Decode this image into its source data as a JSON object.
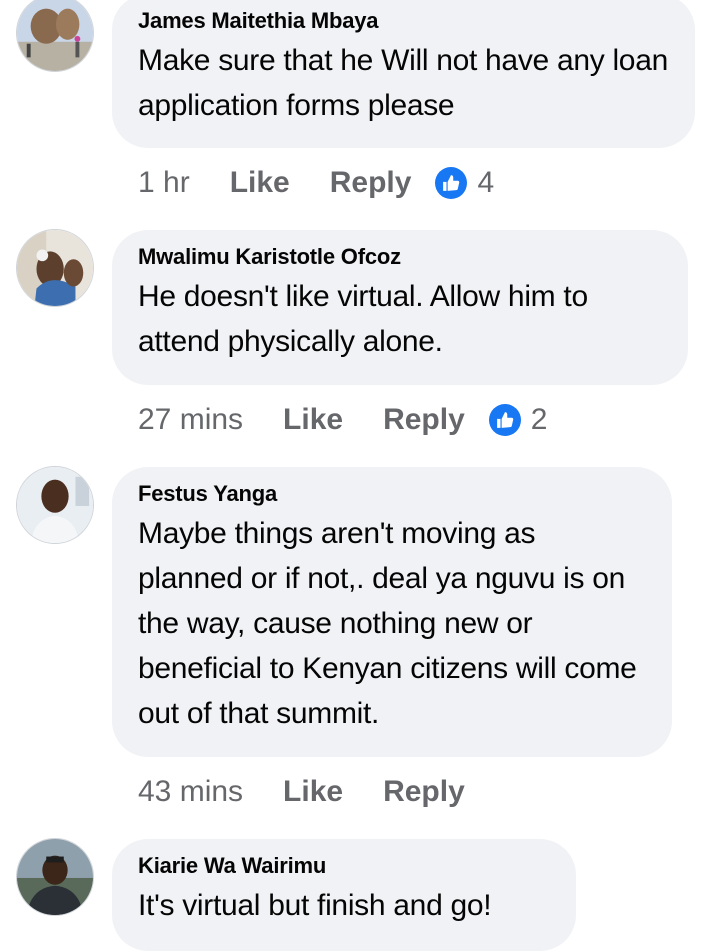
{
  "comments": [
    {
      "author": "James Maitethia Mbaya",
      "text": "Make sure that he Will not have any loan application forms please",
      "time": "1 hr",
      "like_label": "Like",
      "reply_label": "Reply",
      "reactions": "4"
    },
    {
      "author": "Mwalimu Karistotle Ofcoz",
      "text": "He doesn't like virtual. Allow him to attend physically alone.",
      "time": "27 mins",
      "like_label": "Like",
      "reply_label": "Reply",
      "reactions": "2"
    },
    {
      "author": "Festus Yanga",
      "text": "Maybe things aren't moving as planned or if not,. deal ya nguvu is on the way, cause nothing new or beneficial to Kenyan citizens will come out of that summit.",
      "time": "43 mins",
      "like_label": "Like",
      "reply_label": "Reply"
    },
    {
      "author": "Kiarie Wa Wairimu",
      "text": "It's virtual but finish and go!"
    }
  ],
  "colors": {
    "bubble": "#f0f2f5",
    "meta_text": "#65676b",
    "like_badge": "#1877f2"
  },
  "icons": {
    "reaction": "thumbs-up-icon"
  }
}
